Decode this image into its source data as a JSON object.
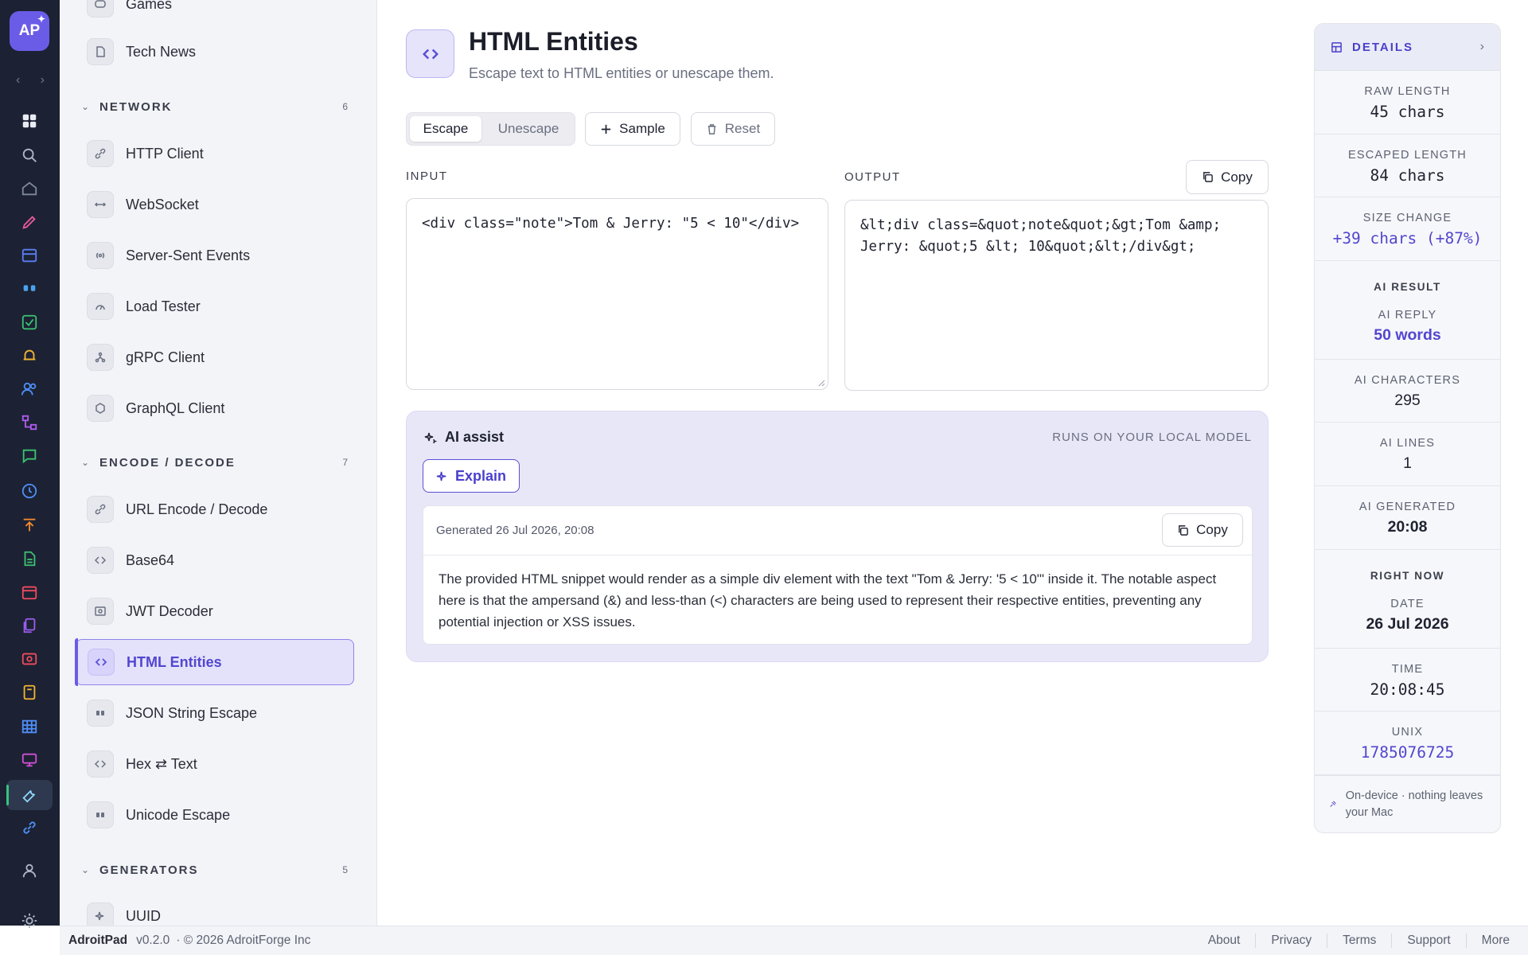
{
  "app": {
    "logo": "AP"
  },
  "sidebar": {
    "items_top": [
      {
        "label": "Games",
        "icon": "gamepad-icon"
      },
      {
        "label": "Tech News",
        "icon": "newspaper-icon"
      }
    ],
    "sections": [
      {
        "title": "NETWORK",
        "count": "6",
        "items": [
          {
            "label": "HTTP Client",
            "icon": "link-icon"
          },
          {
            "label": "WebSocket",
            "icon": "arrows-horizontal-icon"
          },
          {
            "label": "Server-Sent Events",
            "icon": "broadcast-icon"
          },
          {
            "label": "Load Tester",
            "icon": "gauge-icon"
          },
          {
            "label": "gRPC Client",
            "icon": "network-nodes-icon"
          },
          {
            "label": "GraphQL Client",
            "icon": "graphql-icon"
          }
        ]
      },
      {
        "title": "ENCODE / DECODE",
        "count": "7",
        "items": [
          {
            "label": "URL Encode / Decode",
            "icon": "link-icon"
          },
          {
            "label": "Base64",
            "icon": "code-icon"
          },
          {
            "label": "JWT Decoder",
            "icon": "id-card-icon"
          },
          {
            "label": "HTML Entities",
            "icon": "code-icon"
          },
          {
            "label": "JSON String Escape",
            "icon": "quote-icon"
          },
          {
            "label": "Hex ⇄ Text",
            "icon": "code-icon"
          },
          {
            "label": "Unicode Escape",
            "icon": "quote-icon"
          }
        ]
      },
      {
        "title": "GENERATORS",
        "count": "5",
        "items": [
          {
            "label": "UUID",
            "icon": "sparkle-icon"
          }
        ]
      }
    ]
  },
  "header": {
    "title": "HTML Entities",
    "subtitle": "Escape text to HTML entities or unescape them."
  },
  "toolbar": {
    "escape": "Escape",
    "unescape": "Unescape",
    "sample": "Sample",
    "reset": "Reset"
  },
  "input": {
    "label": "INPUT",
    "value": "<div class=\"note\">Tom & Jerry: \"5 < 10\"</div>"
  },
  "output": {
    "label": "OUTPUT",
    "copy": "Copy",
    "value": "&lt;div class=&quot;note&quot;&gt;Tom &amp;\nJerry: &quot;5 &lt; 10&quot;&lt;/div&gt;"
  },
  "ai": {
    "title": "AI assist",
    "runs_note": "RUNS ON YOUR LOCAL MODEL",
    "explain": "Explain",
    "generated": "Generated 26 Jul 2026, 20:08",
    "copy": "Copy",
    "body": "The provided HTML snippet would render as a simple div element with the text \"Tom & Jerry: '5 < 10'\" inside it. The notable aspect here is that the ampersand (&) and less-than (<) characters are being used to represent their respective entities, preventing any potential injection or XSS issues."
  },
  "details": {
    "title": "DETAILS",
    "raw_length_label": "RAW LENGTH",
    "raw_length": "45 chars",
    "escaped_length_label": "ESCAPED LENGTH",
    "escaped_length": "84 chars",
    "size_change_label": "SIZE CHANGE",
    "size_change": "+39 chars (+87%)",
    "ai_result_title": "AI RESULT",
    "ai_reply_label": "AI REPLY",
    "ai_reply": "50 words",
    "ai_chars_label": "AI CHARACTERS",
    "ai_chars": "295",
    "ai_lines_label": "AI LINES",
    "ai_lines": "1",
    "ai_generated_label": "AI GENERATED",
    "ai_generated": "20:08",
    "right_now_title": "RIGHT NOW",
    "date_label": "DATE",
    "date": "26 Jul 2026",
    "time_label": "TIME",
    "time": "20:08:45",
    "unix_label": "UNIX",
    "unix": "1785076725",
    "footer": "On-device · nothing leaves your Mac"
  },
  "footer": {
    "brand": "AdroitPad",
    "version": "v0.2.0",
    "copyright": "· © 2026 AdroitForge Inc",
    "links": [
      "About",
      "Privacy",
      "Terms",
      "Support",
      "More"
    ]
  },
  "colors": {
    "accent": "#6b5ce7",
    "rail": "#1c2233",
    "ai_panel": "#e8e7f8"
  }
}
